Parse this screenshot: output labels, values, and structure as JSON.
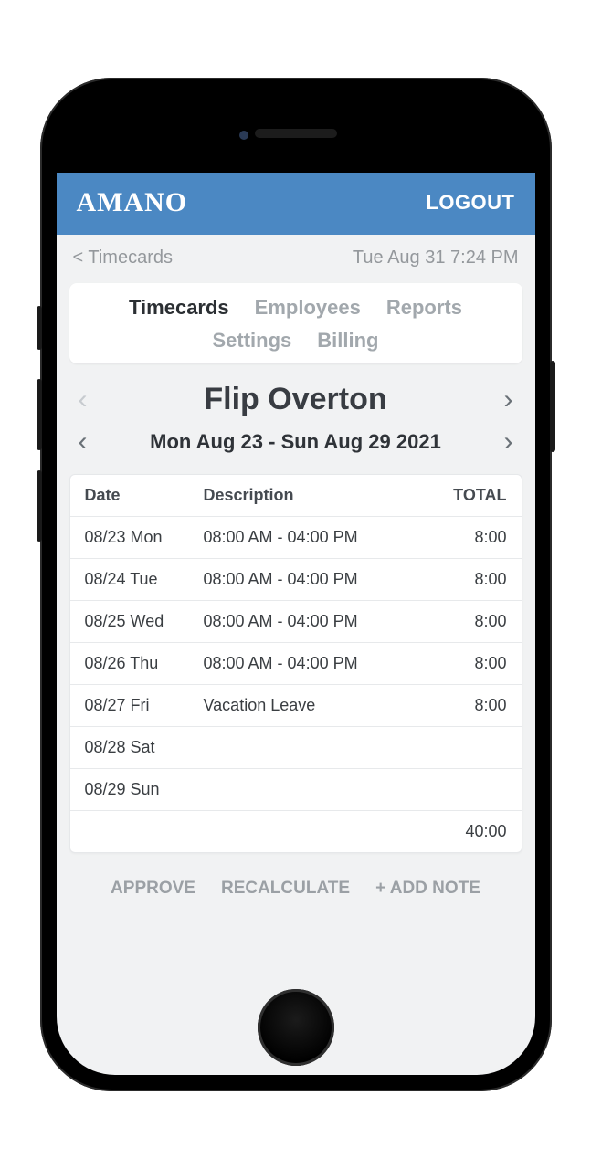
{
  "header": {
    "brand": "AMANO",
    "logout": "LOGOUT"
  },
  "subheader": {
    "back": "< Timecards",
    "datetime": "Tue Aug 31 7:24 PM"
  },
  "tabs": {
    "items": [
      "Timecards",
      "Employees",
      "Reports",
      "Settings",
      "Billing"
    ],
    "active_index": 0
  },
  "employee": {
    "name": "Flip Overton"
  },
  "date_range": "Mon Aug 23 - Sun Aug 29 2021",
  "table": {
    "headers": {
      "date": "Date",
      "description": "Description",
      "total": "TOTAL"
    },
    "rows": [
      {
        "date": "08/23 Mon",
        "description": "08:00 AM - 04:00 PM",
        "total": "8:00"
      },
      {
        "date": "08/24 Tue",
        "description": "08:00 AM - 04:00 PM",
        "total": "8:00"
      },
      {
        "date": "08/25 Wed",
        "description": "08:00 AM - 04:00 PM",
        "total": "8:00"
      },
      {
        "date": "08/26 Thu",
        "description": "08:00 AM - 04:00 PM",
        "total": "8:00"
      },
      {
        "date": "08/27 Fri",
        "description": "Vacation Leave",
        "total": "8:00"
      },
      {
        "date": "08/28 Sat",
        "description": "",
        "total": ""
      },
      {
        "date": "08/29 Sun",
        "description": "",
        "total": ""
      }
    ],
    "footer_total": "40:00"
  },
  "actions": {
    "approve": "APPROVE",
    "recalc": "RECALCULATE",
    "add_note": "+ ADD NOTE"
  }
}
